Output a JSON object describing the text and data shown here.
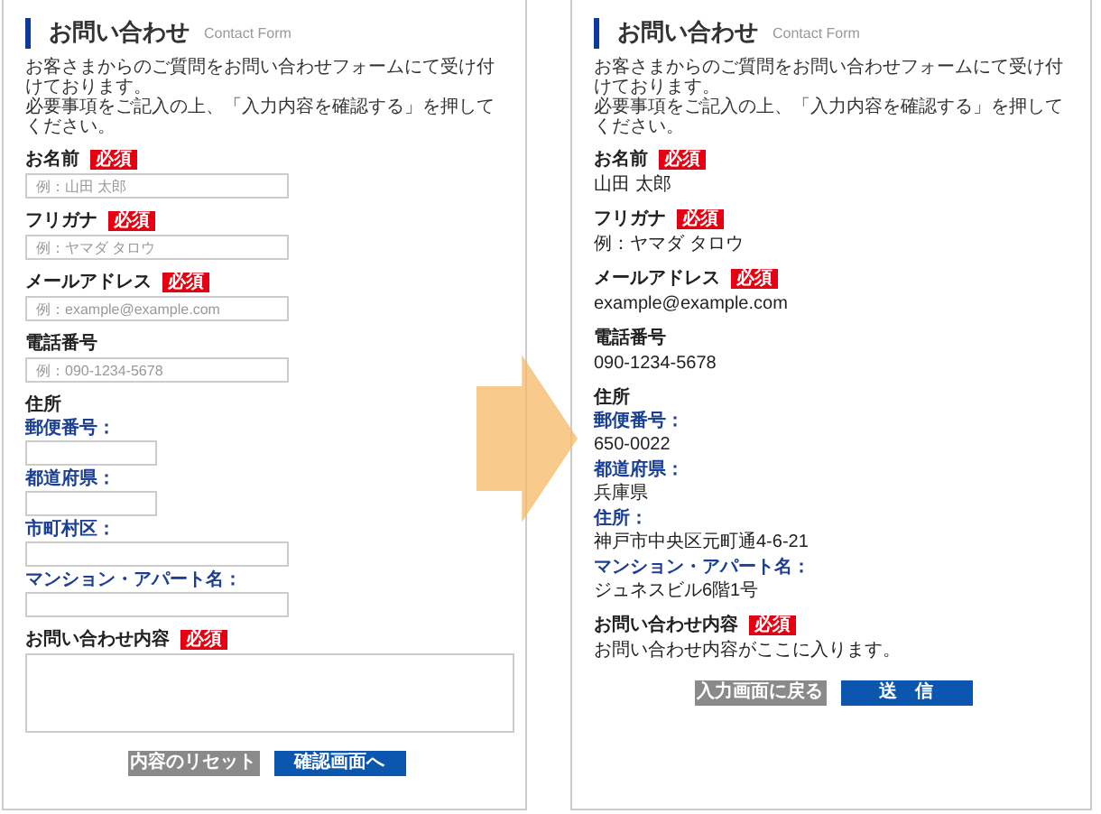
{
  "panels": [
    {
      "title": "お問い合わせ",
      "subtitle": "Contact Form",
      "description": [
        "お客さまからのご質問をお問い合わせフォームにて受け付けております。",
        "必要事項をご記入の上、「入力内容を確認する」を押してください。"
      ],
      "fields": [
        {
          "kind": "text",
          "label": "お名前",
          "badge": "必須",
          "placeholder": "例：山田 太郎"
        },
        {
          "kind": "text",
          "label": "フリガナ",
          "badge": "必須",
          "placeholder": "例：ヤマダ タロウ"
        },
        {
          "kind": "text",
          "label": "メールアドレス",
          "badge": "必須",
          "placeholder": "例：example@example.com"
        },
        {
          "kind": "text",
          "label": "電話番号",
          "placeholder": "例：090-1234-5678"
        },
        {
          "kind": "group",
          "label": "住所",
          "children": [
            {
              "kind": "short",
              "label": "郵便番号："
            },
            {
              "kind": "short",
              "label": "都道府県："
            },
            {
              "kind": "text",
              "label": "市町村区："
            },
            {
              "kind": "text",
              "label": "マンション・アパート名："
            }
          ]
        },
        {
          "kind": "textarea",
          "label": "お問い合わせ内容",
          "badge": "必須"
        }
      ],
      "buttons": [
        {
          "label": "内容のリセット",
          "kind": "secondary"
        },
        {
          "label": "確認画面へ",
          "kind": "primary"
        }
      ]
    },
    {
      "title": "お問い合わせ",
      "subtitle": "Contact Form",
      "description": [
        "お客さまからのご質問をお問い合わせフォームにて受け付けております。",
        "必要事項をご記入の上、「入力内容を確認する」を押してください。"
      ],
      "fields": [
        {
          "kind": "value",
          "label": "お名前",
          "badge": "必須",
          "value": "山田 太郎"
        },
        {
          "kind": "value",
          "label": "フリガナ",
          "badge": "必須",
          "value": "例：ヤマダ タロウ"
        },
        {
          "kind": "value",
          "label": "メールアドレス",
          "badge": "必須",
          "value": "example@example.com"
        },
        {
          "kind": "value",
          "label": "電話番号",
          "value": "090-1234-5678"
        },
        {
          "kind": "group",
          "label": "住所",
          "children": [
            {
              "kind": "value",
              "label": "郵便番号：",
              "value": "650-0022"
            },
            {
              "kind": "value",
              "label": "都道府県：",
              "value": "兵庫県"
            },
            {
              "kind": "value",
              "label": "住所：",
              "value": "神戸市中央区元町通4-6-21"
            },
            {
              "kind": "value",
              "label": "マンション・アパート名：",
              "value": "ジュネスビル6階1号"
            }
          ]
        },
        {
          "kind": "value",
          "label": "お問い合わせ内容",
          "badge": "必須",
          "value": "お問い合わせ内容がここに入ります。"
        }
      ],
      "buttons": [
        {
          "label": "入力画面に戻る",
          "kind": "secondary"
        },
        {
          "label": "送　信",
          "kind": "primary"
        }
      ]
    }
  ]
}
